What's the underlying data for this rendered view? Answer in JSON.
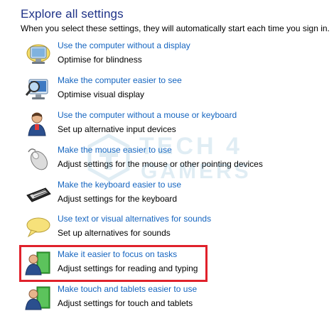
{
  "header": {
    "title": "Explore all settings",
    "subtitle": "When you select these settings, they will automatically start each time you sign in."
  },
  "items": [
    {
      "icon": "monitor-icon",
      "link": "Use the computer without a display",
      "desc": "Optimise for blindness"
    },
    {
      "icon": "magnifier-monitor-icon",
      "link": "Make the computer easier to see",
      "desc": "Optimise visual display"
    },
    {
      "icon": "user-icon",
      "link": "Use the computer without a mouse or keyboard",
      "desc": "Set up alternative input devices"
    },
    {
      "icon": "mouse-icon",
      "link": "Make the mouse easier to use",
      "desc": "Adjust settings for the mouse or other pointing devices"
    },
    {
      "icon": "keyboard-icon",
      "link": "Make the keyboard easier to use",
      "desc": "Adjust settings for the keyboard"
    },
    {
      "icon": "speech-bubble-icon",
      "link": "Use text or visual alternatives for sounds",
      "desc": "Set up alternatives for sounds"
    },
    {
      "icon": "user-green-panel-icon",
      "link": "Make it easier to focus on tasks",
      "desc": "Adjust settings for reading and typing"
    },
    {
      "icon": "user-tablet-icon",
      "link": "Make touch and tablets easier to use",
      "desc": "Adjust settings for touch and tablets"
    }
  ],
  "watermark": {
    "line1": "TECH 4",
    "line2": "GAMERS"
  },
  "colors": {
    "heading": "#1e3287",
    "link": "#1565c0",
    "highlight": "#e0212b"
  }
}
